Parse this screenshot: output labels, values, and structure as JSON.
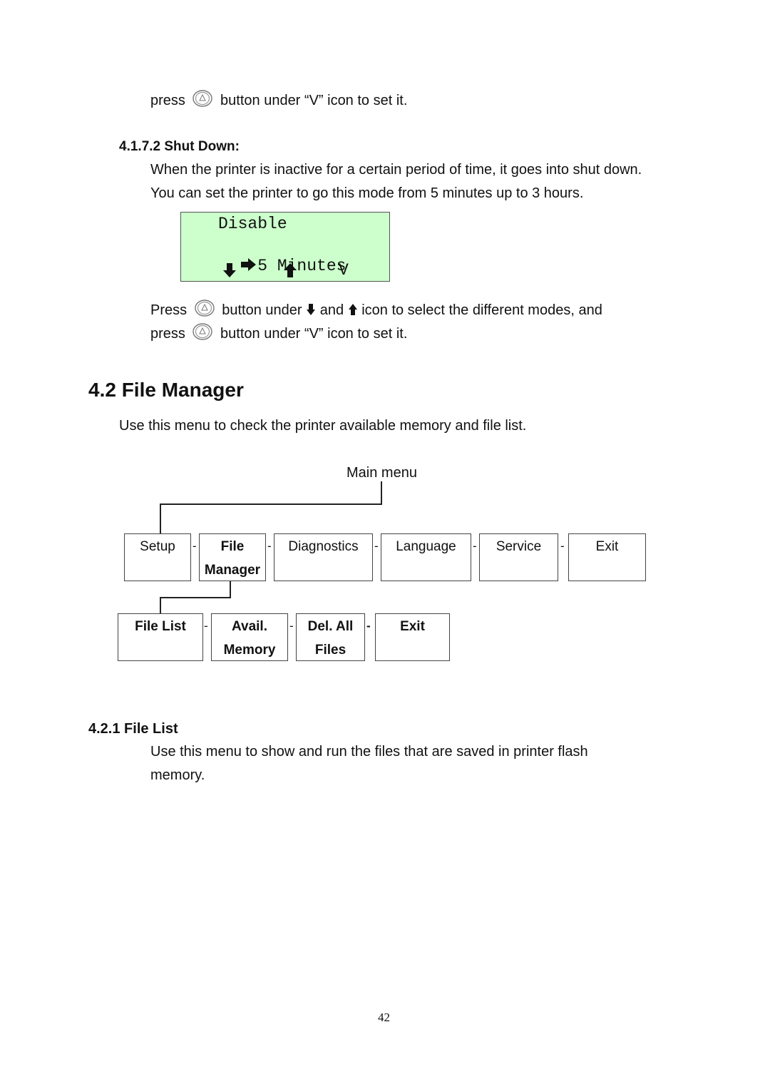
{
  "top_instruction": {
    "before": "press",
    "after": "button under “V” icon to set it.",
    "icon": "panel-button-icon"
  },
  "shut_down": {
    "heading": "4.1.7.2 Shut Down:",
    "line1": "When the printer is inactive for a certain period of time, it goes into shut down.",
    "line2": "You can set the printer to go this mode from 5 minutes up to 3 hours.",
    "lcd": {
      "background": "#ccffcc",
      "line1": "Disable",
      "line2": "5 Minutes",
      "selector_icon": "right-arrow-icon",
      "soft_keys": [
        {
          "icon": "down-arrow-icon",
          "label": ""
        },
        {
          "icon": "up-arrow-icon",
          "label": ""
        },
        {
          "icon": "",
          "label": "V"
        }
      ]
    },
    "instruction1": {
      "before": "Press",
      "middle1": "button under",
      "middle2": "and",
      "after": "icon to select the different modes, and"
    },
    "instruction2": {
      "before": "press",
      "after": "button under “V” icon to set it."
    }
  },
  "file_manager": {
    "heading": "4.2 File Manager",
    "intro": "Use this menu to check the printer available memory and file list.",
    "diagram": {
      "root_label": "Main menu",
      "main_items": [
        {
          "line1": "Setup",
          "line2": "",
          "bold": false
        },
        {
          "line1": "File",
          "line2": "Manager",
          "bold": true
        },
        {
          "line1": "Diagnostics",
          "line2": "",
          "bold": false
        },
        {
          "line1": "Language",
          "line2": "",
          "bold": false
        },
        {
          "line1": "Service",
          "line2": "",
          "bold": false
        },
        {
          "line1": "Exit",
          "line2": "",
          "bold": false
        }
      ],
      "sub_items": [
        {
          "line1": "File List",
          "line2": ""
        },
        {
          "line1": "Avail.",
          "line2": "Memory"
        },
        {
          "line1": "Del. All",
          "line2": "Files"
        },
        {
          "line1": "Exit",
          "line2": ""
        }
      ],
      "separator": "-"
    }
  },
  "file_list": {
    "heading": "4.2.1 File List",
    "line1": "Use this menu to show and run the files that are saved in printer flash",
    "line2": "memory."
  },
  "page_number": "42"
}
